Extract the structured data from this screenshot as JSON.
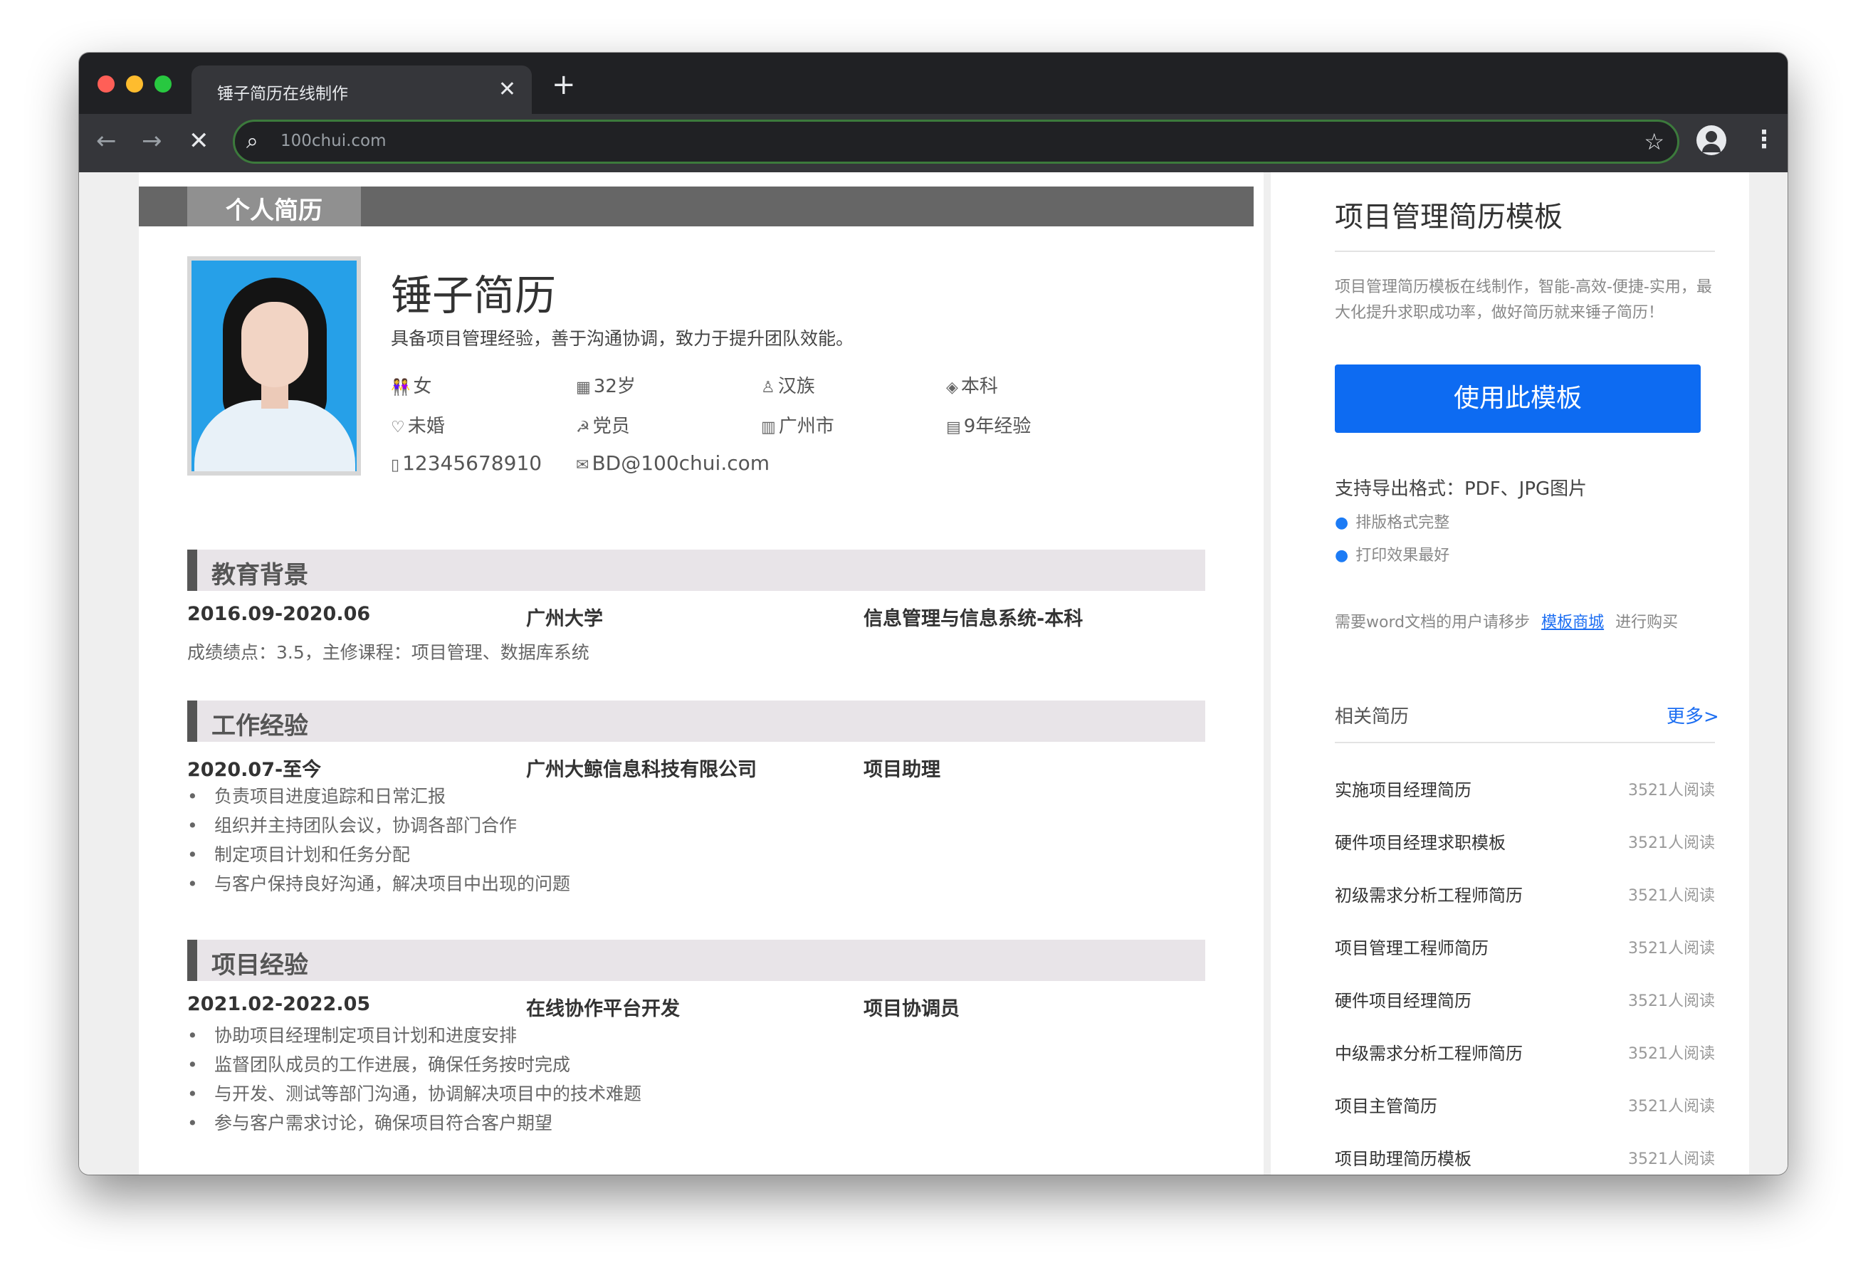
{
  "browser": {
    "tab_title": "锤子简历在线制作",
    "tab_close": "✕",
    "new_tab": "+",
    "url": "100chui.com"
  },
  "resume": {
    "header_title": "个人简历",
    "name": "锤子简历",
    "intro": "具备项目管理经验，善于沟通协调，致力于提升团队效能。",
    "info": {
      "gender": "女",
      "age": "32岁",
      "ethnicity": "汉族",
      "degree": "本科",
      "marital": "未婚",
      "politics": "党员",
      "city": "广州市",
      "experience": "9年经验",
      "phone": "12345678910",
      "email": "BD@100chui.com"
    },
    "education": {
      "title": "教育背景",
      "period": "2016.09-2020.06",
      "school": "广州大学",
      "major": "信息管理与信息系统-本科",
      "detail": "成绩绩点：3.5，主修课程：项目管理、数据库系统"
    },
    "work": {
      "title": "工作经验",
      "period": "2020.07-至今",
      "company": "广州大鲸信息科技有限公司",
      "role": "项目助理",
      "bullets": [
        "负责项目进度追踪和日常汇报",
        "组织并主持团队会议，协调各部门合作",
        "制定项目计划和任务分配",
        "与客户保持良好沟通，解决项目中出现的问题"
      ]
    },
    "project": {
      "title": "项目经验",
      "period": "2021.02-2022.05",
      "name": "在线协作平台开发",
      "role": "项目协调员",
      "bullets": [
        "协助项目经理制定项目计划和进度安排",
        "监督团队成员的工作进展，确保任务按时完成",
        "与开发、测试等部门沟通，协调解决项目中的技术难题",
        "参与客户需求讨论，确保项目符合客户期望"
      ]
    }
  },
  "sidebar": {
    "title": "项目管理简历模板",
    "description": "项目管理简历模板在线制作，智能-高效-便捷-实用，最大化提升求职成功率，做好简历就来锤子简历！",
    "use_button": "使用此模板",
    "export_formats": "支持导出格式：PDF、JPG图片",
    "features": [
      "排版格式完整",
      "打印效果最好"
    ],
    "word_prefix": "需要word文档的用户请移步",
    "word_link": "模板商城",
    "word_suffix": "进行购买",
    "related_title": "相关简历",
    "more_label": "更多>",
    "related": [
      {
        "name": "实施项目经理简历",
        "reads": "3521人阅读"
      },
      {
        "name": "硬件项目经理求职模板",
        "reads": "3521人阅读"
      },
      {
        "name": "初级需求分析工程师简历",
        "reads": "3521人阅读"
      },
      {
        "name": "项目管理工程师简历",
        "reads": "3521人阅读"
      },
      {
        "name": "硬件项目经理简历",
        "reads": "3521人阅读"
      },
      {
        "name": "中级需求分析工程师简历",
        "reads": "3521人阅读"
      },
      {
        "name": "项目主管简历",
        "reads": "3521人阅读"
      },
      {
        "name": "项目助理简历模板",
        "reads": "3521人阅读"
      }
    ]
  }
}
